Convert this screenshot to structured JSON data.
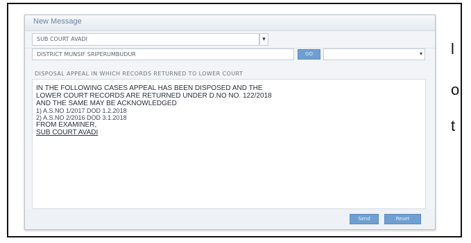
{
  "page": {
    "edge_letters": [
      "l",
      "o",
      "t"
    ]
  },
  "dialog": {
    "title": "New Message",
    "recipient_select": {
      "value": "SUB COURT AVADI"
    },
    "search_input": {
      "value": "DISTRICT MUNSIF SRIPERUMBUDUR"
    },
    "go_button": "GO",
    "secondary_select": {
      "value": ""
    },
    "subject": "DISPOSAL APPEAL IN WHICH RECORDS RETURNED TO LOWER COURT",
    "body_lines": [
      "IN THE FOLLOWING CASES APPEAL HAS BEEN DISPOSED AND THE",
      "LOWER COURT RECORDS ARE RETURNED UNDER D.NO NO. 122/2018",
      "AND THE SAME MAY BE ACKNOWLEDGED",
      "1) A.S.NO 1/2017 DOD 1.2.2018",
      "2) A.S.NO 2/2016 DOD 3.1.2018",
      "FROM EXAMINER,",
      "SUB COURT AVADI"
    ],
    "send_button": "Send",
    "reset_button": "Reset"
  }
}
